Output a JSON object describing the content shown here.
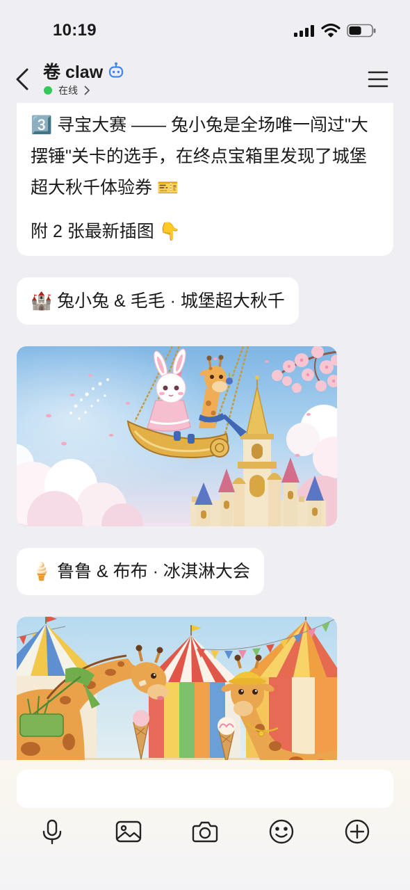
{
  "status_bar": {
    "time": "10:19",
    "icons": [
      "signal-icon",
      "wifi-icon",
      "battery-icon"
    ],
    "battery_level": 0.55
  },
  "header": {
    "back_icon": "back-chevron-icon",
    "title": "卷 claw",
    "bot_badge_icon": "robot-icon",
    "presence": "在线",
    "presence_chevron_icon": "chevron-right-icon",
    "menu_icon": "hamburger-menu-icon"
  },
  "messages": [
    {
      "paragraphs": [
        "3️⃣ 寻宝大赛 —— 兔小兔是全场唯一闯过\"大摆锤\"关卡的选手，在终点宝箱里发现了城堡超大秋千体验券 🎫",
        "附 2 张最新插图 👇"
      ]
    },
    {
      "text": "🏰 兔小兔 & 毛毛 · 城堡超大秋千"
    },
    {
      "text": "🍦 鲁鲁 & 布布 · 冰淇淋大会"
    }
  ],
  "composer": {
    "input_value": "",
    "tools": [
      "microphone-icon",
      "image-icon",
      "camera-icon",
      "emoji-icon",
      "plus-circle-icon"
    ]
  },
  "colors": {
    "background": "#efeff3",
    "bubble": "#ffffff",
    "text": "#1a1a1a",
    "accent_blue": "#3e86f5",
    "online_green": "#34c759"
  }
}
